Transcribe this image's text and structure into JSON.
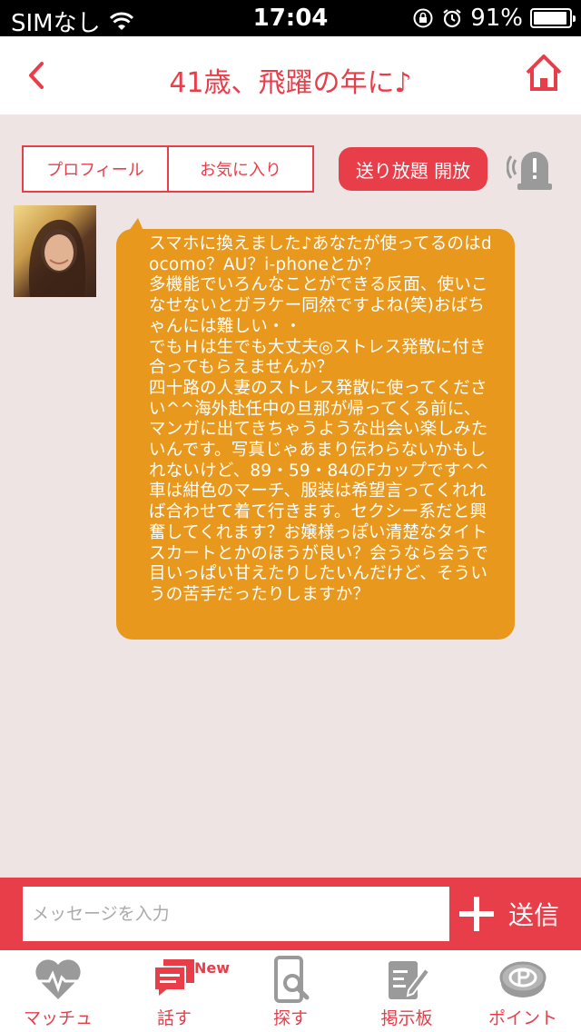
{
  "status_bar": {
    "carrier": "SIMなし",
    "time": "17:04",
    "battery": "91%"
  },
  "header": {
    "title": "41歳、飛躍の年に♪"
  },
  "actions": {
    "profile_label": "プロフィール",
    "favorite_label": "お気に入り",
    "unlimited_label": "送り放題 開放"
  },
  "message": {
    "text": "スマホに換えました♪あなたが使ってるのはdocomo？AU？i-phoneとか？\n多機能でいろんなことができる反面、使いこなせないとガラケー同然ですよね(笑)おばちゃんには難しい・・\nでもＨは生でも大丈夫◎ストレス発散に付き合ってもらえませんか？\n四十路の人妻のストレス発散に使ってください^^海外赴任中の旦那が帰ってくる前に、マンガに出てきちゃうような出会い楽しみたいんです。写真じゃあまり伝わらないかもしれないけど、89・59・84のFカップです^^車は紺色のマーチ、服装は希望言ってくれれば合わせて着て行きます。セクシー系だと興奮してくれます？お嬢様っぽい清楚なタイトスカートとかのほうが良い？会うなら会うで目いっぱい甘えたりしたいんだけど、そういうの苦手だったりしますか？"
  },
  "input": {
    "placeholder": "メッセージを入力",
    "send_label": "送信"
  },
  "tabs": [
    {
      "label": "マッチュ",
      "icon": "heart-pulse-icon"
    },
    {
      "label": "話す",
      "icon": "chat-bubble-icon",
      "badge": "New"
    },
    {
      "label": "探す",
      "icon": "phone-search-icon"
    },
    {
      "label": "掲示板",
      "icon": "board-edit-icon"
    },
    {
      "label": "ポイント",
      "icon": "point-coin-icon"
    }
  ],
  "colors": {
    "accent": "#e83e4a",
    "bubble": "#e8981c",
    "background": "#efe4e4",
    "inactive_icon": "#9a9a9a"
  }
}
